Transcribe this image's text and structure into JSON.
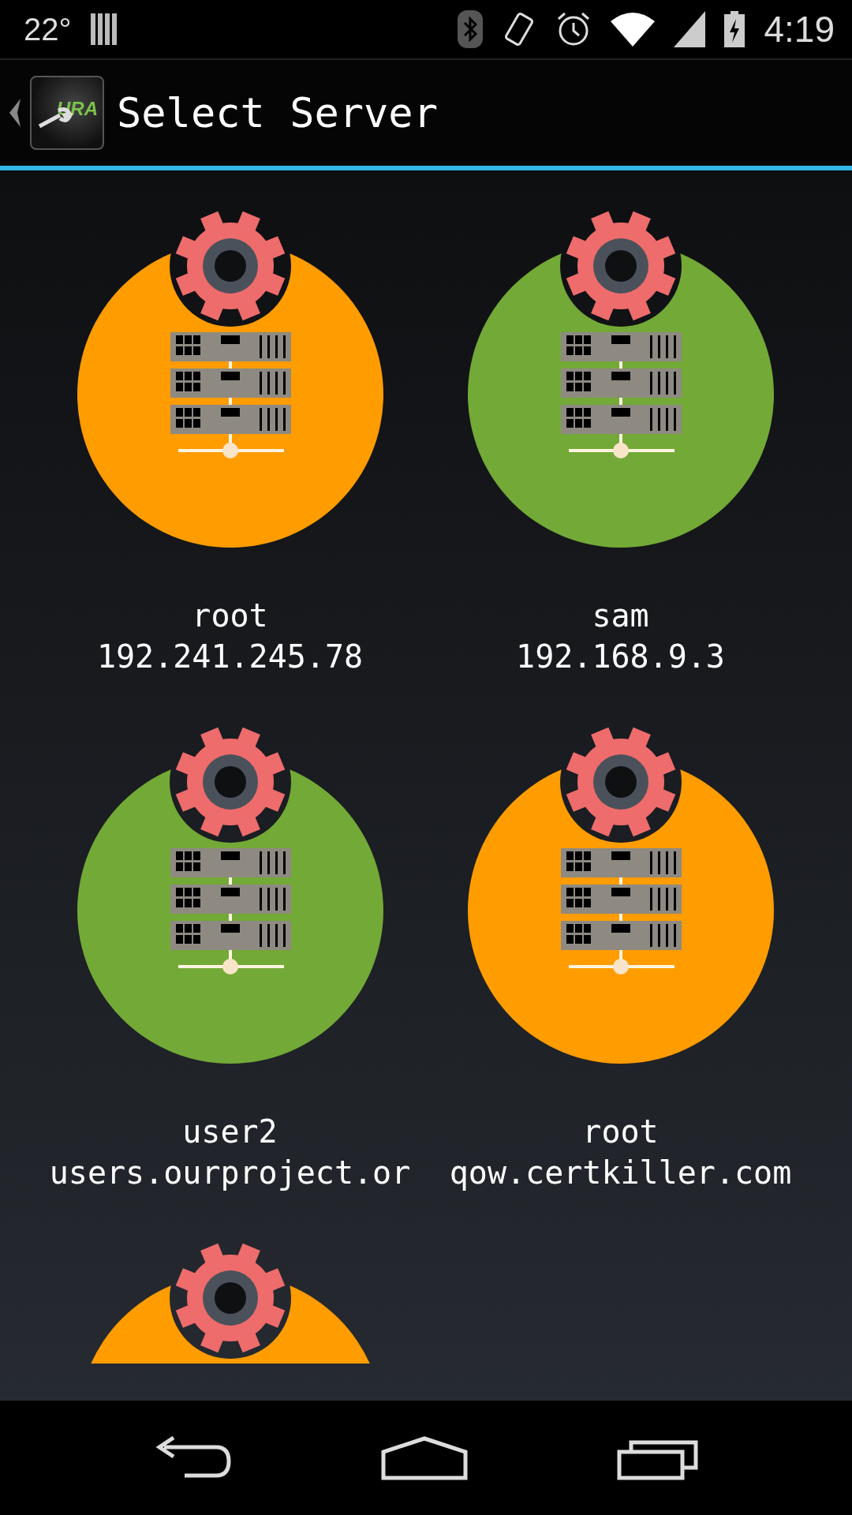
{
  "status_bar": {
    "temperature": "22°",
    "time": "4:19"
  },
  "app_bar": {
    "logo_text": "URA",
    "title": "Select Server"
  },
  "servers": [
    {
      "user": "root",
      "host": "192.241.245.78",
      "color": "#ff9c00"
    },
    {
      "user": "sam",
      "host": "192.168.9.3",
      "color": "#73a936"
    },
    {
      "user": "user2",
      "host": "users.ourproject.or",
      "color": "#73a936"
    },
    {
      "user": "root",
      "host": "qow.certkiller.com",
      "color": "#ff9c00"
    },
    {
      "color": "#ff9c00"
    }
  ]
}
